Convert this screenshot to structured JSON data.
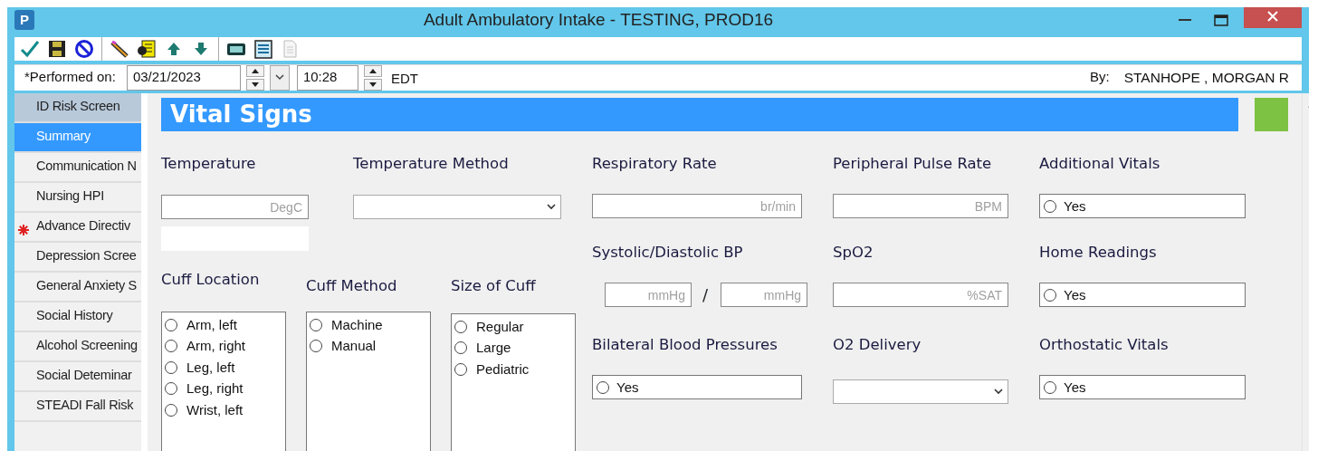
{
  "window": {
    "title": "Adult Ambulatory Intake - TESTING, PROD16",
    "app_letter": "P"
  },
  "performed": {
    "label": "*Performed on:",
    "date": "03/21/2023",
    "time": "10:28",
    "timezone": "EDT",
    "by_label": "By:",
    "by_name": "STANHOPE , MORGAN R"
  },
  "sidebar": {
    "items": [
      {
        "label": "ID Risk Screen",
        "selected": false,
        "shaded": true,
        "required": false
      },
      {
        "label": "Summary",
        "selected": true,
        "shaded": false,
        "required": false
      },
      {
        "label": "Communication N",
        "selected": false,
        "shaded": false,
        "required": false
      },
      {
        "label": "Nursing HPI",
        "selected": false,
        "shaded": false,
        "required": false
      },
      {
        "label": "Advance Directiv",
        "selected": false,
        "shaded": false,
        "required": true
      },
      {
        "label": "Depression Scree",
        "selected": false,
        "shaded": false,
        "required": false
      },
      {
        "label": "General Anxiety S",
        "selected": false,
        "shaded": false,
        "required": false
      },
      {
        "label": "Social History",
        "selected": false,
        "shaded": false,
        "required": false
      },
      {
        "label": "Alcohol Screening",
        "selected": false,
        "shaded": false,
        "required": false
      },
      {
        "label": "Social Deteminar",
        "selected": false,
        "shaded": false,
        "required": false
      },
      {
        "label": "STEADI Fall Risk",
        "selected": false,
        "shaded": false,
        "required": false
      }
    ]
  },
  "section": {
    "title": "Vital Signs"
  },
  "temperature": {
    "label": "Temperature",
    "placeholder": "DegC"
  },
  "temperature_method": {
    "label": "Temperature Method"
  },
  "cuff_lists": [
    {
      "label": "Cuff Location",
      "options": [
        {
          "label": "Arm, left",
          "selected": false
        },
        {
          "label": "Arm, right",
          "selected": false
        },
        {
          "label": "Leg, left",
          "selected": false
        },
        {
          "label": "Leg, right",
          "selected": false
        },
        {
          "label": "Wrist, left",
          "selected": false
        }
      ]
    },
    {
      "label": "Cuff Method",
      "options": [
        {
          "label": "Machine",
          "selected": false
        },
        {
          "label": "Manual",
          "selected": false
        }
      ]
    },
    {
      "label": "Size of Cuff",
      "options": [
        {
          "label": "Regular",
          "selected": false
        },
        {
          "label": "Large",
          "selected": false
        },
        {
          "label": "Pediatric",
          "selected": false
        }
      ]
    }
  ],
  "fields": [
    {
      "kind": "text",
      "label": "Respiratory Rate",
      "placeholder": "br/min"
    },
    {
      "kind": "text",
      "label": "Peripheral Pulse Rate",
      "placeholder": "BPM"
    },
    {
      "kind": "yesno",
      "label": "Additional Vitals",
      "option": "Yes",
      "selected": false
    },
    {
      "kind": "bp",
      "label": "Systolic/Diastolic BP",
      "placeholder": "mmHg",
      "separator": "/",
      "placeholder_2": "mmHg"
    },
    {
      "kind": "text",
      "label": "SpO2",
      "placeholder": "%SAT"
    },
    {
      "kind": "yesno",
      "label": "Home Readings",
      "option": "Yes",
      "selected": false
    },
    {
      "kind": "yesno",
      "label": "Bilateral Blood Pressures",
      "option": "Yes",
      "selected": false
    },
    {
      "kind": "select",
      "label": "O2 Delivery"
    },
    {
      "kind": "yesno",
      "label": "Orthostatic Vitals",
      "option": "Yes",
      "selected": false
    }
  ]
}
